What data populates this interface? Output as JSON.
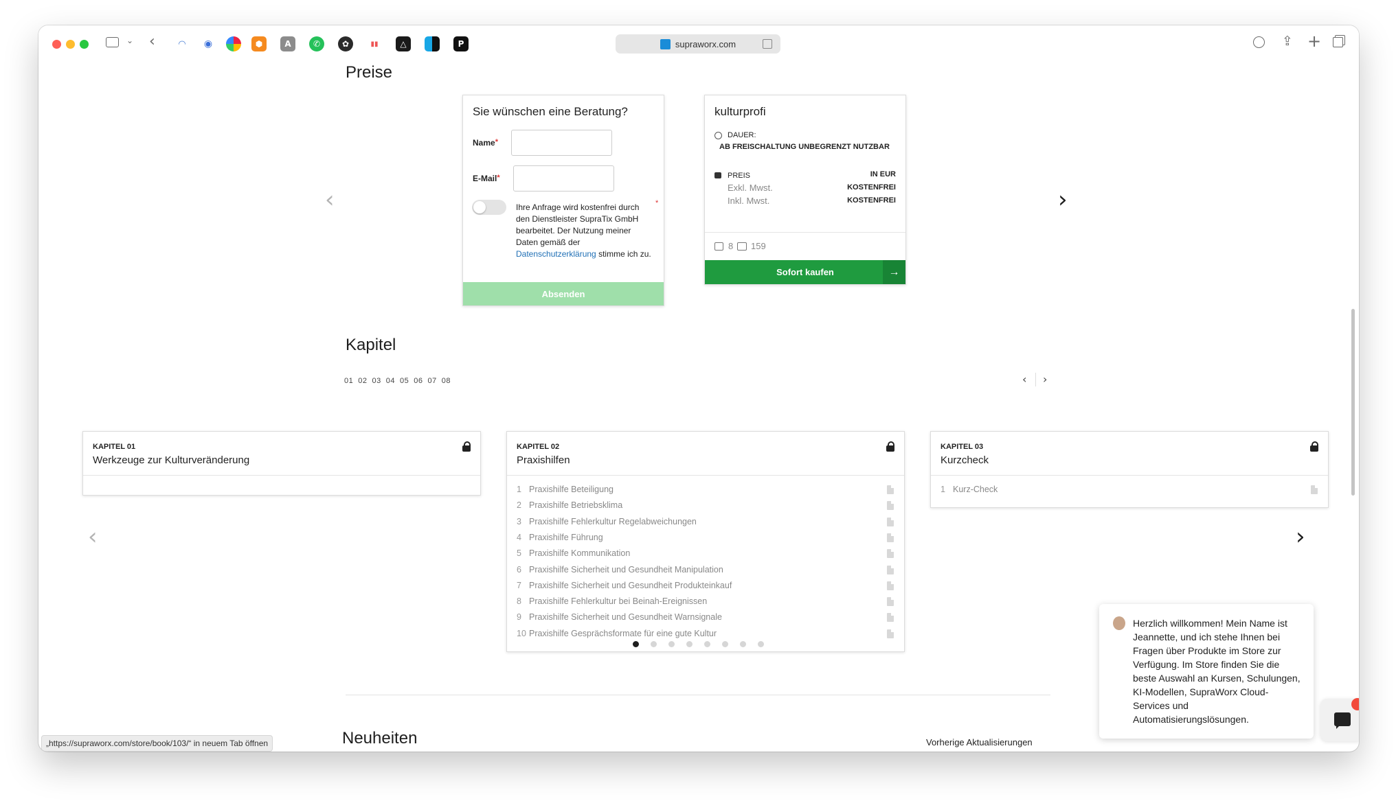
{
  "browser": {
    "url": "supraworx.com",
    "status_link": "„https://supraworx.com/store/book/103/“ in neuem Tab öffnen"
  },
  "sections": {
    "preise": "Preise",
    "kapitel": "Kapitel",
    "neuheiten": "Neuheiten",
    "vorherige": "Vorherige Aktualisierungen"
  },
  "form": {
    "title": "Sie wünschen eine Beratung?",
    "name_label": "Name",
    "email_label": "E-Mail",
    "required_mark": "*",
    "consent_text": "Ihre Anfrage wird kostenfrei durch den Dienstleister SupraTix GmbH bearbeitet. Der Nutzung meiner Daten gemäß der",
    "consent_link": "Datenschutzerklärung",
    "consent_suffix": "stimme ich zu.",
    "submit": "Absenden"
  },
  "product": {
    "title": "kulturprofi",
    "duration_label": "DAUER:",
    "duration_value": "AB FREISCHALTUNG UNBEGRENZT NUTZBAR",
    "price_label": "PREIS",
    "currency": "IN EUR",
    "excl_label": "Exkl. Mwst.",
    "excl_value": "KOSTENFREI",
    "incl_label": "Inkl. Mwst.",
    "incl_value": "KOSTENFREI",
    "stat_chapters": "8",
    "stat_files": "159",
    "buy": "Sofort kaufen"
  },
  "chapter_numbers": [
    "01",
    "02",
    "03",
    "04",
    "05",
    "06",
    "07",
    "08"
  ],
  "chapters": [
    {
      "label": "KAPITEL 01",
      "title": "Werkzeuge zur Kulturveränderung",
      "items": []
    },
    {
      "label": "KAPITEL 02",
      "title": "Praxishilfen",
      "items": [
        {
          "n": "1",
          "title": "Praxishilfe Beteiligung"
        },
        {
          "n": "2",
          "title": "Praxishilfe Betriebsklima"
        },
        {
          "n": "3",
          "title": "Praxishilfe Fehlerkultur Regelabweichungen"
        },
        {
          "n": "4",
          "title": "Praxishilfe Führung"
        },
        {
          "n": "5",
          "title": "Praxishilfe Kommunikation"
        },
        {
          "n": "6",
          "title": "Praxishilfe Sicherheit und Gesundheit Manipulation"
        },
        {
          "n": "7",
          "title": "Praxishilfe Sicherheit und Gesundheit Produkteinkauf"
        },
        {
          "n": "8",
          "title": "Praxishilfe Fehlerkultur bei Beinah-Ereignissen"
        },
        {
          "n": "9",
          "title": "Praxishilfe Sicherheit und Gesundheit Warnsignale"
        },
        {
          "n": "10",
          "title": "Praxishilfe Gesprächsformate für eine gute Kultur"
        }
      ]
    },
    {
      "label": "KAPITEL 03",
      "title": "Kurzcheck",
      "items": [
        {
          "n": "1",
          "title": "Kurz-Check"
        }
      ]
    }
  ],
  "carousel": {
    "dot_count": 8,
    "active_dot": 0
  },
  "chat": {
    "message": "Herzlich willkommen! Mein Name ist Jeannette, und ich stehe Ihnen bei Fragen über Produkte im Store zur Verfügung. Im Store finden Sie die beste Auswahl an Kursen, Schulungen, KI-Modellen, SupraWorx Cloud-Services und Automatisierungslösungen."
  },
  "colors": {
    "buy_green": "#1f9b3f",
    "submit_green": "#9fdfaa",
    "chat_badge": "#f24a3b",
    "link_blue": "#1f6fb5"
  }
}
